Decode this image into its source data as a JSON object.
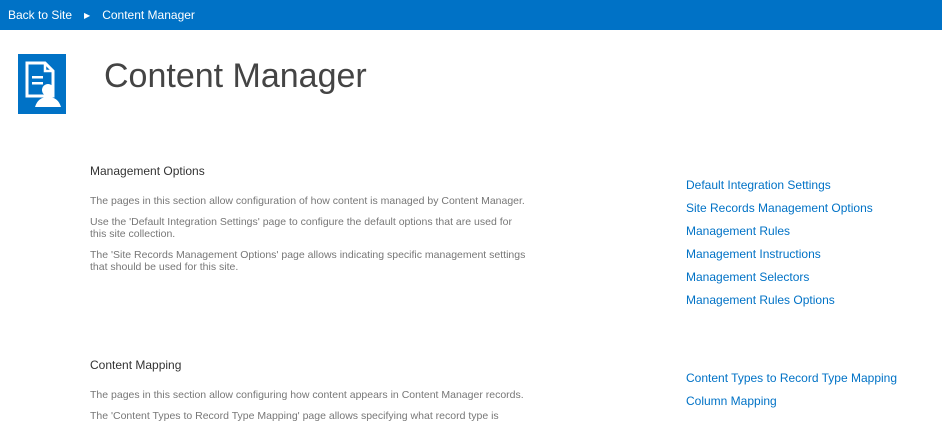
{
  "breadcrumb": {
    "back_label": "Back to Site",
    "current_label": "Content Manager"
  },
  "page": {
    "title": "Content Manager"
  },
  "sections": [
    {
      "heading": "Management Options",
      "paragraphs": [
        "The pages in this section allow configuration of how content is managed by Content Manager.",
        "Use the 'Default Integration Settings' page to configure the default options that are used for this site collection.",
        "The 'Site Records Management Options' page allows indicating specific management settings that should be used for this site."
      ],
      "links": [
        "Default Integration Settings",
        "Site Records Management Options",
        "Management Rules",
        "Management Instructions",
        "Management Selectors",
        "Management Rules Options"
      ]
    },
    {
      "heading": "Content Mapping",
      "paragraphs": [
        "The pages in this section allow configuring how content appears in Content Manager records.",
        "The 'Content Types to Record Type Mapping' page allows specifying what record type is"
      ],
      "links": [
        "Content Types to Record Type Mapping",
        "Column Mapping"
      ]
    }
  ],
  "colors": {
    "accent": "#0072c6",
    "link": "#0072c6",
    "body_text": "#777777"
  },
  "icons": {
    "logo": "content-manager-logo-icon",
    "separator": "breadcrumb-arrow-icon"
  }
}
